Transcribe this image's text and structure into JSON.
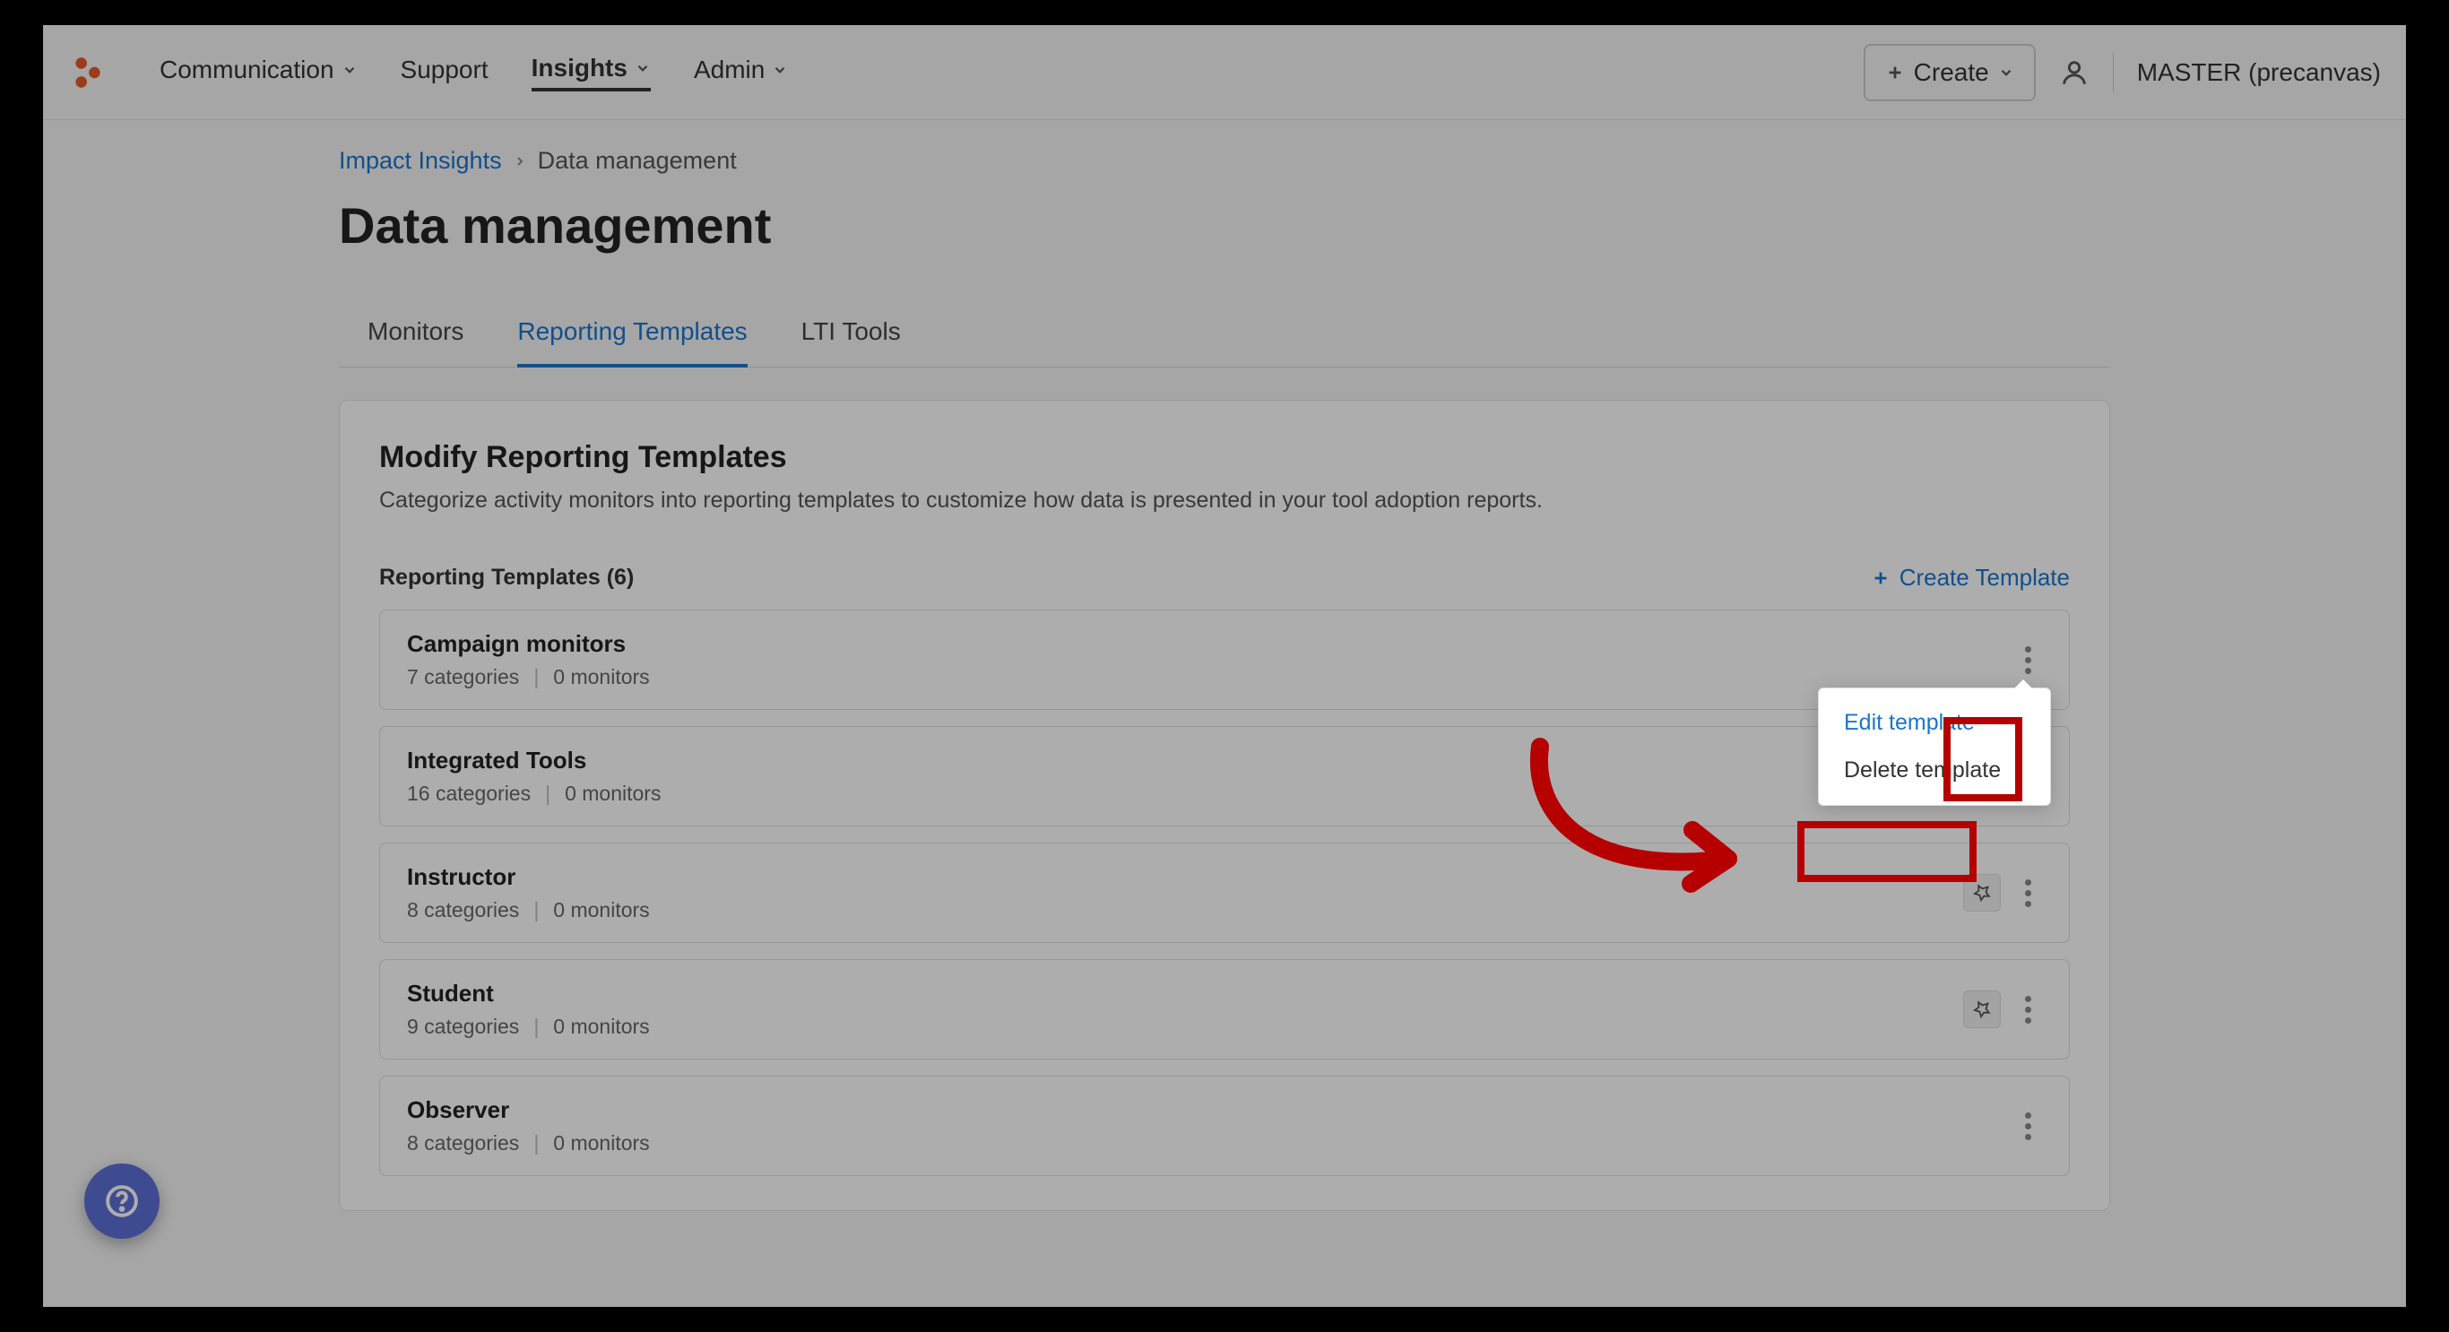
{
  "nav": {
    "items": [
      {
        "label": "Communication",
        "dropdown": true,
        "active": false
      },
      {
        "label": "Support",
        "dropdown": false,
        "active": false
      },
      {
        "label": "Insights",
        "dropdown": true,
        "active": true
      },
      {
        "label": "Admin",
        "dropdown": true,
        "active": false
      }
    ],
    "create_label": "Create",
    "env_label": "MASTER (precanvas)"
  },
  "breadcrumb": {
    "parent": "Impact Insights",
    "current": "Data management"
  },
  "page_title": "Data management",
  "tabs": [
    {
      "label": "Monitors",
      "active": false
    },
    {
      "label": "Reporting Templates",
      "active": true
    },
    {
      "label": "LTI Tools",
      "active": false
    }
  ],
  "panel": {
    "heading": "Modify Reporting Templates",
    "description": "Categorize activity monitors into reporting templates to customize how data is presented in your tool adoption reports.",
    "list_label": "Reporting Templates (6)",
    "create_template_label": "Create Template"
  },
  "templates": [
    {
      "name": "Campaign monitors",
      "categories": "7 categories",
      "monitors": "0 monitors",
      "pinned": false,
      "menu_open": true
    },
    {
      "name": "Integrated Tools",
      "categories": "16 categories",
      "monitors": "0 monitors",
      "pinned": false,
      "menu_open": false
    },
    {
      "name": "Instructor",
      "categories": "8 categories",
      "monitors": "0 monitors",
      "pinned": true,
      "menu_open": false
    },
    {
      "name": "Student",
      "categories": "9 categories",
      "monitors": "0 monitors",
      "pinned": true,
      "menu_open": false
    },
    {
      "name": "Observer",
      "categories": "8 categories",
      "monitors": "0 monitors",
      "pinned": false,
      "menu_open": false
    }
  ],
  "dropdown": {
    "edit": "Edit template",
    "delete": "Delete template"
  },
  "colors": {
    "accent": "#1a75cf",
    "annotation": "#b60000",
    "fab": "#5d6fd6"
  }
}
